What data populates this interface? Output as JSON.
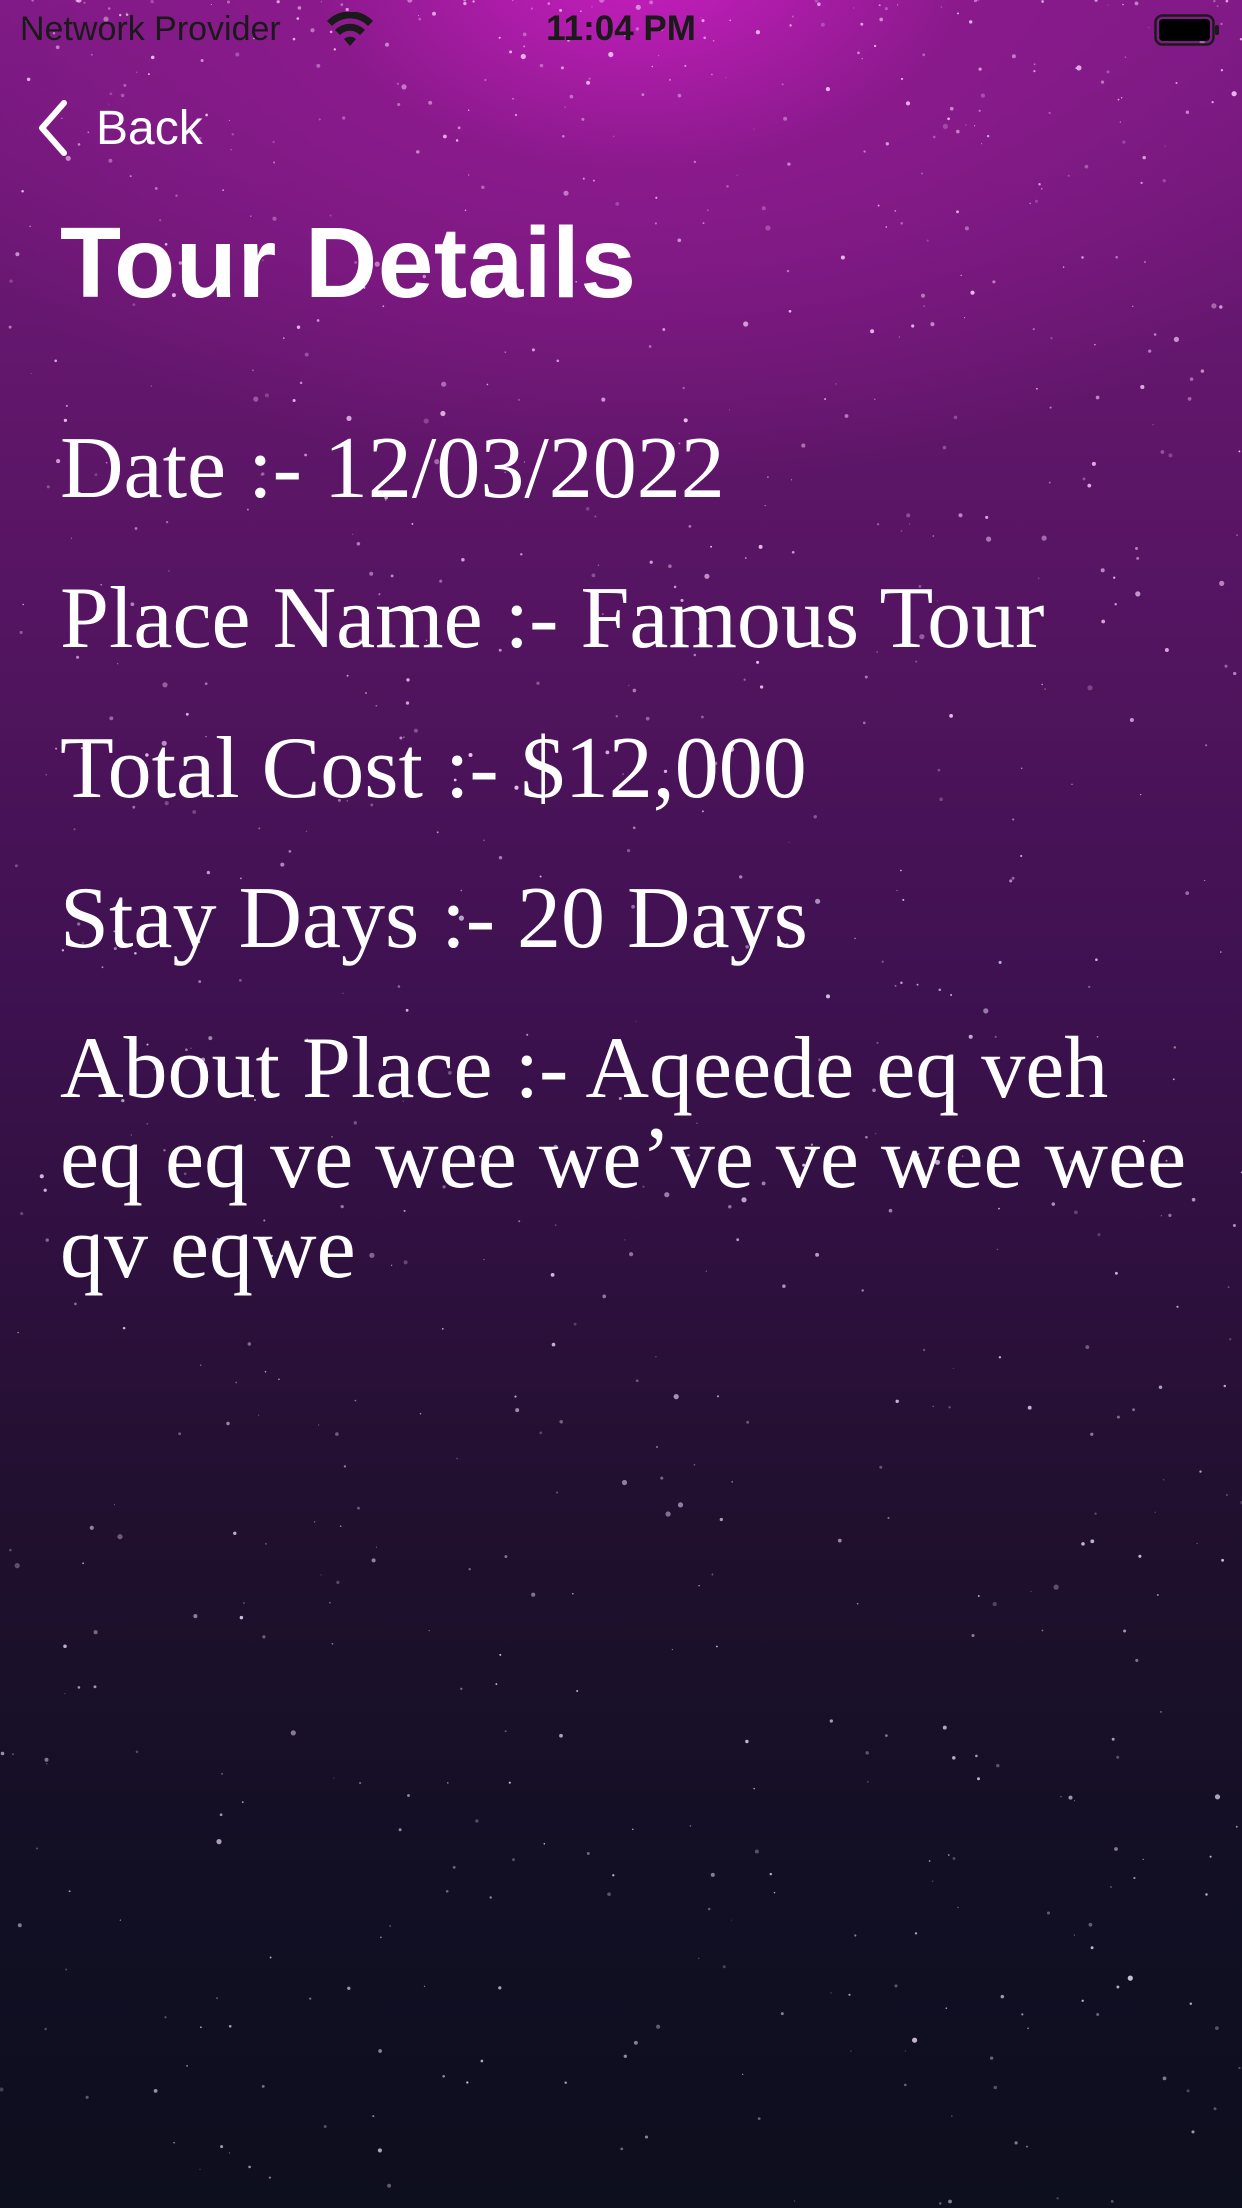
{
  "status_bar": {
    "carrier": "Network Provider",
    "time": "11:04 PM",
    "wifi_icon": "wifi-icon",
    "battery_icon": "battery-icon"
  },
  "nav": {
    "back_label": "Back",
    "back_icon": "chevron-left-icon"
  },
  "page": {
    "title": "Tour Details"
  },
  "details": {
    "date": "Date :- 12/03/2022",
    "place_name": "Place Name :- Famous Tour",
    "total_cost": "Total Cost :- $12,000",
    "stay_days": "Stay Days :- 20 Days",
    "about_place": "About Place :- Aqeede eq veh eq eq ve wee we’ve ve wee wee qv eqwe"
  },
  "colors": {
    "text": "#ffffff",
    "gradient_top": "#c91ec0",
    "gradient_bottom": "#0d0e1e"
  }
}
